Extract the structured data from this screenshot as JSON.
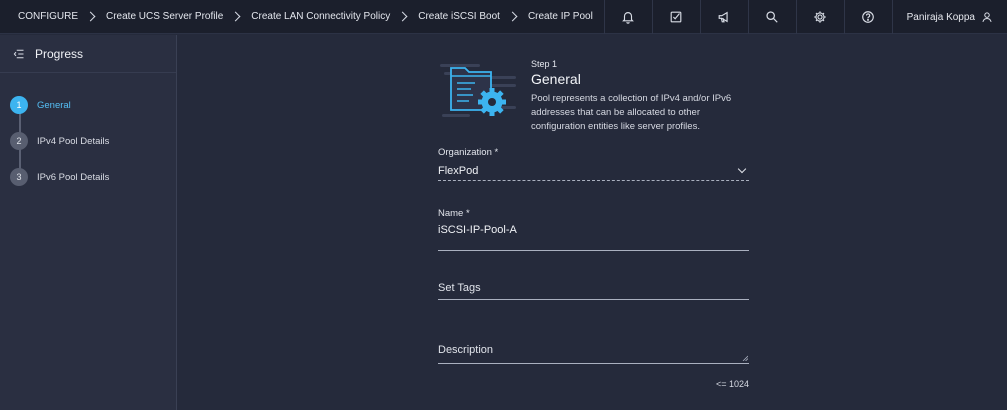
{
  "breadcrumb": {
    "items": [
      "CONFIGURE",
      "Create UCS Server Profile",
      "Create LAN Connectivity Policy",
      "Create iSCSI Boot"
    ],
    "current": "Create IP Pool"
  },
  "toolbar": {
    "icons": [
      "bell-icon",
      "task-check-icon",
      "megaphone-icon",
      "search-icon",
      "gear-icon",
      "help-icon"
    ],
    "user_name": "Paniraja Koppa"
  },
  "sidebar": {
    "title": "Progress",
    "steps": [
      {
        "number": "1",
        "label": "General",
        "active": true
      },
      {
        "number": "2",
        "label": "IPv4 Pool Details",
        "active": false
      },
      {
        "number": "3",
        "label": "IPv6 Pool Details",
        "active": false
      }
    ]
  },
  "main": {
    "kicker": "Step 1",
    "title": "General",
    "description": "Pool represents a collection of IPv4 and/or IPv6 addresses that can be allocated to other configuration entities like server profiles."
  },
  "form": {
    "organization": {
      "label": "Organization *",
      "value": "FlexPod"
    },
    "name": {
      "label": "Name *",
      "value": "iSCSI-IP-Pool-A"
    },
    "tags": {
      "placeholder": "Set Tags"
    },
    "description": {
      "placeholder": "Description",
      "counter": "<= 1024"
    }
  },
  "colors": {
    "accent": "#3cb4f0",
    "background": "#252a3b",
    "topbar": "#1b1f2c",
    "sidebar": "#2a2f41"
  }
}
